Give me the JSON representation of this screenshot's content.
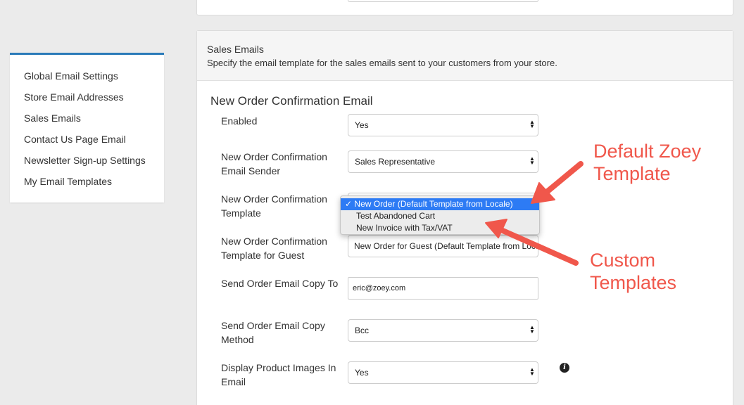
{
  "sidebar": {
    "items": [
      {
        "label": "Global Email Settings"
      },
      {
        "label": "Store Email Addresses"
      },
      {
        "label": "Sales Emails"
      },
      {
        "label": "Contact Us Page Email"
      },
      {
        "label": "Newsletter Sign-up Settings"
      },
      {
        "label": "My Email Templates"
      }
    ]
  },
  "section": {
    "title": "Sales Emails",
    "description": "Specify the email template for the sales emails sent to your customers from your store.",
    "group_title": "New Order Confirmation Email"
  },
  "fields": {
    "enabled": {
      "label": "Enabled",
      "value": "Yes"
    },
    "sender": {
      "label": "New Order Confirmation Email Sender",
      "value": "Sales Representative"
    },
    "template": {
      "label": "New Order Confirmation Template"
    },
    "guest_template": {
      "label": "New Order Confirmation Template for Guest",
      "value": "New Order for Guest (Default Template from Locale)"
    },
    "copy_to": {
      "label": "Send Order Email Copy To",
      "value": "eric@zoey.com"
    },
    "copy_method": {
      "label": "Send Order Email Copy Method",
      "value": "Bcc"
    },
    "product_images": {
      "label": "Display Product Images In Email",
      "value": "Yes"
    }
  },
  "dropdown": {
    "check": "✓",
    "options": [
      {
        "label": "New Order (Default Template from Locale)",
        "selected": true
      },
      {
        "label": "Test Abandoned Cart",
        "selected": false
      },
      {
        "label": "New Invoice with Tax/VAT",
        "selected": false
      }
    ]
  },
  "annotations": {
    "default_line1": "Default Zoey",
    "default_line2": "Template",
    "custom_line1": "Custom",
    "custom_line2": "Templates",
    "color": "#f0574b"
  },
  "colors": {
    "accent": "#2b7bb9",
    "dropdown_selected": "#2d7bf4"
  }
}
